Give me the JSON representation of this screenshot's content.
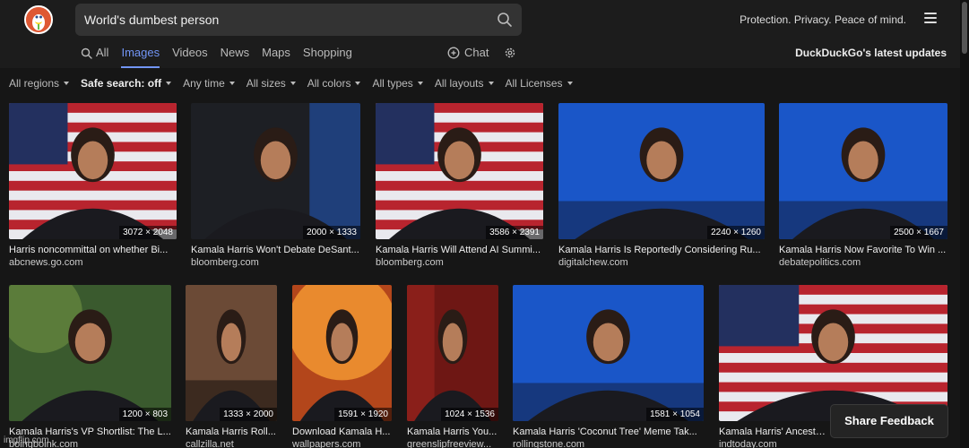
{
  "search": {
    "query": "World's dumbest person"
  },
  "header": {
    "tagline": "Protection. Privacy. Peace of mind."
  },
  "tabs": [
    {
      "label": "All"
    },
    {
      "label": "Images"
    },
    {
      "label": "Videos"
    },
    {
      "label": "News"
    },
    {
      "label": "Maps"
    },
    {
      "label": "Shopping"
    }
  ],
  "chat": {
    "label": "Chat"
  },
  "updates": {
    "label": "DuckDuckGo's latest updates"
  },
  "filters": [
    {
      "label": "All regions"
    },
    {
      "label": "Safe search: off"
    },
    {
      "label": "Any time"
    },
    {
      "label": "All sizes"
    },
    {
      "label": "All colors"
    },
    {
      "label": "All types"
    },
    {
      "label": "All layouts"
    },
    {
      "label": "All Licenses"
    }
  ],
  "results_row1": [
    {
      "title": "Harris noncommittal on whether Bi...",
      "source": "abcnews.go.com",
      "dims": "3072 × 2048",
      "bg": "flag"
    },
    {
      "title": "Kamala Harris Won't Debate DeSant...",
      "source": "bloomberg.com",
      "dims": "2000 × 1333",
      "bg": "dark"
    },
    {
      "title": "Kamala Harris Will Attend AI Summi...",
      "source": "bloomberg.com",
      "dims": "3586 × 2391",
      "bg": "flag"
    },
    {
      "title": "Kamala Harris Is Reportedly Considering Ru...",
      "source": "digitalchew.com",
      "dims": "2240 × 1260",
      "bg": "blue"
    },
    {
      "title": "Kamala Harris Now Favorite To Win ...",
      "source": "debatepolitics.com",
      "dims": "2500 × 1667",
      "bg": "blue"
    }
  ],
  "results_row2": [
    {
      "title": "Kamala Harris's VP Shortlist: The L...",
      "source": "boingboink.com",
      "dims": "1200 × 803",
      "bg": "green"
    },
    {
      "title": "Kamala Harris Roll...",
      "source": "callzilla.net",
      "dims": "1333 × 2000",
      "bg": "room"
    },
    {
      "title": "Download Kamala H...",
      "source": "wallpapers.com",
      "dims": "1591 × 1920",
      "bg": "orange"
    },
    {
      "title": "Kamala Harris You...",
      "source": "greenslipfreeview...",
      "dims": "1024 × 1536",
      "bg": "red"
    },
    {
      "title": "Kamala Harris 'Coconut Tree' Meme Tak...",
      "source": "rollingstone.com",
      "dims": "1581 × 1054",
      "bg": "blue"
    },
    {
      "title": "Kamala Harris' Ancestral...",
      "source": "indtoday.com",
      "dims": "",
      "bg": "flag"
    }
  ],
  "feedback": {
    "label": "Share Feedback"
  },
  "watermark": {
    "text": "imgflip.com"
  }
}
